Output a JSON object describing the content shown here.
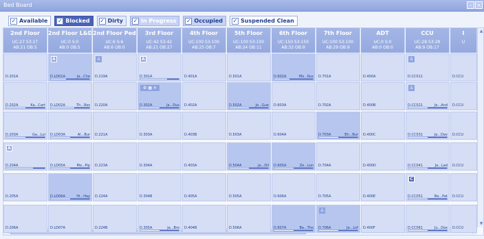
{
  "window": {
    "title": "Bed Board"
  },
  "filters": [
    {
      "label": "Available",
      "checked": true
    },
    {
      "label": "Blocked",
      "checked": true
    },
    {
      "label": "Dirty",
      "checked": true
    },
    {
      "label": "In Progress",
      "checked": true
    },
    {
      "label": "Occupied",
      "checked": true
    },
    {
      "label": "Suspended Clean",
      "checked": true
    }
  ],
  "columns": [
    {
      "name": "2nd Floor",
      "s1": "UC:27 S3:27",
      "s2": "AB:21 OB:5"
    },
    {
      "name": "2nd Floor L&D",
      "s1": "UC:0 S:0",
      "s2": "AB:0 OB:5"
    },
    {
      "name": "2nd Floor Peds",
      "s1": "UC:6 S:6",
      "s2": "AB:6 OB:0"
    },
    {
      "name": "3rd Floor",
      "s1": "UC:42 S3:42",
      "s2": "AB:21 OB:27"
    },
    {
      "name": "4th Floor",
      "s1": "UC:100 S3:100",
      "s2": "AB:25 OB:7"
    },
    {
      "name": "5th Floor",
      "s1": "UC:100 S3:100",
      "s2": "AB:24 OB:11"
    },
    {
      "name": "6th Floor",
      "s1": "UC:150 S3:150",
      "s2": "AB:32 OB:9"
    },
    {
      "name": "7th Floor",
      "s1": "UC:100 S3:100",
      "s2": "AB:29 OB:9"
    },
    {
      "name": "ADT",
      "s1": "UC:0 S:0",
      "s2": "AB:0 OB:0"
    },
    {
      "name": "CCU",
      "s1": "UC:28 S3:28",
      "s2": "AB:9 OB:17"
    },
    {
      "name": "I",
      "s1": "U",
      "s2": ""
    }
  ],
  "rows": [
    [
      {
        "room": "D.201A"
      },
      {
        "room": "D.LD01A",
        "guest": "Ja...Che",
        "bar": 0.6,
        "dark": true,
        "icon": "A"
      },
      {
        "room": "D.219A",
        "icon2": "tooth"
      },
      {
        "room": "D.301A",
        "bar": 0.3,
        "icon": "A"
      },
      {
        "room": "D.401A"
      },
      {
        "room": "D.501A"
      },
      {
        "room": "D.602A",
        "guest": "Mo...Rus",
        "bar": 0.6,
        "dark": true
      },
      {
        "room": "D.701A"
      },
      {
        "room": "D.400A"
      },
      {
        "room": "D.CC011",
        "icon2": "tooth"
      },
      {
        "room": "D.CCU"
      }
    ],
    [
      {
        "room": "D.202A",
        "guest": "Ka...Cart",
        "bar": 0.5
      },
      {
        "room": "D.LD02A",
        "guest": "Th...Ros",
        "bar": 0.4
      },
      {
        "room": "D.220A"
      },
      {
        "room": "D.302A",
        "guest": "Ja...Dus",
        "bar": 0.5,
        "dark": true,
        "icons": "⚙ ▦ ✕"
      },
      {
        "room": "D.402A"
      },
      {
        "room": "D.502A",
        "guest": "Jo...Gue",
        "bar": 0.5,
        "dark": true
      },
      {
        "room": "D.603A"
      },
      {
        "room": "D.702A"
      },
      {
        "room": "D.400B"
      },
      {
        "room": "D.CC021",
        "guest": "Je...And",
        "bar": 0.5,
        "icon2": "tooth"
      },
      {
        "room": "D.CCU"
      }
    ],
    [
      {
        "room": "D.203A",
        "guest": "Ga...Lui",
        "bar": 0.5
      },
      {
        "room": "D.LD03A",
        "guest": "Al...Bur",
        "bar": 0.5
      },
      {
        "room": "D.221A"
      },
      {
        "room": "D.303A"
      },
      {
        "room": "D.403B"
      },
      {
        "room": "D.503A"
      },
      {
        "room": "D.604A"
      },
      {
        "room": "D.703A",
        "guest": "Eh...Bur",
        "bar": 0.5,
        "dark": true
      },
      {
        "room": "D.400C"
      },
      {
        "room": "D.CC031",
        "guest": "Ja...Dav",
        "bar": 0.5
      },
      {
        "room": "D.CCU"
      }
    ],
    [
      {
        "room": "D.204A",
        "bar": 0.3,
        "icon": "A"
      },
      {
        "room": "D.LD05A",
        "guest": "Mo...Pip",
        "bar": 0.5
      },
      {
        "room": "D.223A"
      },
      {
        "room": "D.304A"
      },
      {
        "room": "D.403A"
      },
      {
        "room": "D.504A",
        "guest": "Ja...Dil",
        "bar": 0.5,
        "dark": true
      },
      {
        "room": "D.605A",
        "guest": "Ze...Lon",
        "bar": 0.5,
        "dark": true
      },
      {
        "room": "D.704A"
      },
      {
        "room": "D.400D"
      },
      {
        "room": "D.CC041",
        "guest": "Ja...Lad",
        "bar": 0.5
      },
      {
        "room": "D.CCU"
      }
    ],
    [
      {
        "room": "D.205A"
      },
      {
        "room": "D.LD06A",
        "guest": "Hi...Hay",
        "bar": 0.5,
        "dark": true
      },
      {
        "room": "D.224A"
      },
      {
        "room": "D.304B"
      },
      {
        "room": "D.405A"
      },
      {
        "room": "D.505A"
      },
      {
        "room": "D.606A"
      },
      {
        "room": "D.705A"
      },
      {
        "room": "D.400E"
      },
      {
        "room": "D.CC051",
        "guest": "Be...Pat",
        "bar": 0.5,
        "icon": "C",
        "iconDark": true
      },
      {
        "room": "D.CCU"
      }
    ],
    [
      {
        "room": "D.206A"
      },
      {
        "room": "D.LD07A"
      },
      {
        "room": "D.224B"
      },
      {
        "room": "D.305A",
        "guest": "Ja...Bro",
        "bar": 0.5
      },
      {
        "room": "D.404B"
      },
      {
        "room": "D.506A"
      },
      {
        "room": "D.607A",
        "guest": "Ba...Tho",
        "bar": 0.5,
        "dark": true
      },
      {
        "room": "D.706A",
        "guest": "Ja...Lof",
        "bar": 0.5,
        "dark": true,
        "icon2": "tooth"
      },
      {
        "room": "D.400F"
      },
      {
        "room": "D.CC061",
        "guest": "Ju...Dox",
        "bar": 0.5
      },
      {
        "room": "D.CCU"
      }
    ]
  ]
}
